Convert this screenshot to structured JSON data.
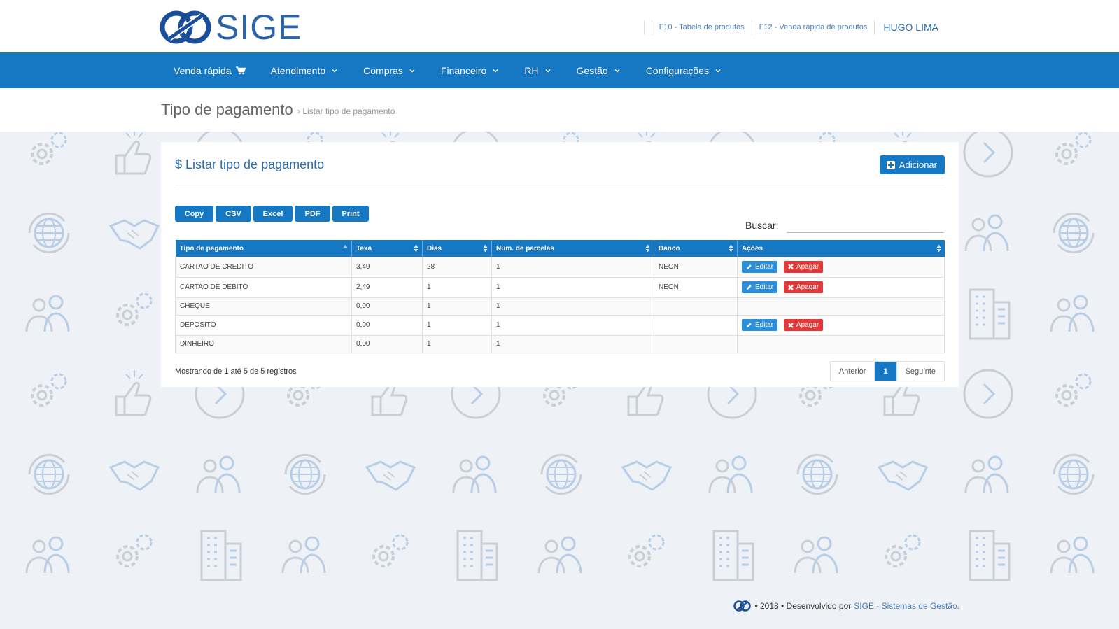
{
  "brand": {
    "name": "SIGE"
  },
  "top_links": {
    "f10": "F10 - Tabela de produtos",
    "f12": "F12 - Venda rápida de produtos",
    "user": "HUGO LIMA"
  },
  "nav": {
    "items": [
      {
        "label": "Venda rápida",
        "icon": "cart-icon"
      },
      {
        "label": "Atendimento",
        "icon": "chevron-down-icon"
      },
      {
        "label": "Compras",
        "icon": "chevron-down-icon"
      },
      {
        "label": "Financeiro",
        "icon": "chevron-down-icon"
      },
      {
        "label": "RH",
        "icon": "chevron-down-icon"
      },
      {
        "label": "Gestão",
        "icon": "chevron-down-icon"
      },
      {
        "label": "Configurações",
        "icon": "chevron-down-icon"
      }
    ]
  },
  "page": {
    "title": "Tipo de pagamento",
    "breadcrumb": "› Listar tipo de pagamento"
  },
  "card": {
    "title": "$ Listar tipo de pagamento",
    "add_label": "Adicionar",
    "exports": [
      "Copy",
      "CSV",
      "Excel",
      "PDF",
      "Print"
    ],
    "search_label": "Buscar:",
    "search_value": ""
  },
  "table": {
    "columns": [
      "Tipo de pagamento",
      "Taxa",
      "Dias",
      "Num. de parcelas",
      "Banco",
      "Ações"
    ],
    "rows": [
      {
        "tipo": "CARTAO DE CREDITO",
        "taxa": "3,49",
        "dias": "28",
        "parcelas": "1",
        "banco": "NEON",
        "actions": true
      },
      {
        "tipo": "CARTAO DE DEBITO",
        "taxa": "2,49",
        "dias": "1",
        "parcelas": "1",
        "banco": "NEON",
        "actions": true
      },
      {
        "tipo": "CHEQUE",
        "taxa": "0,00",
        "dias": "1",
        "parcelas": "1",
        "banco": "",
        "actions": false
      },
      {
        "tipo": "DEPOSITO",
        "taxa": "0,00",
        "dias": "1",
        "parcelas": "1",
        "banco": "",
        "actions": true
      },
      {
        "tipo": "DINHEIRO",
        "taxa": "0,00",
        "dias": "1",
        "parcelas": "1",
        "banco": "",
        "actions": false
      }
    ],
    "edit_label": "Editar",
    "delete_label": "Apagar"
  },
  "info": "Mostrando de 1 até 5 de 5 registros",
  "pagination": {
    "prev": "Anterior",
    "current": "1",
    "next": "Seguinte"
  },
  "footer": {
    "text": "• 2018 • Desenvolvido por",
    "link": "SIGE - Sistemas de Gestão."
  },
  "colors": {
    "primary": "#1677c2",
    "danger": "#e03a3a",
    "edit": "#2d8fd9",
    "background": "#eef1f5"
  }
}
